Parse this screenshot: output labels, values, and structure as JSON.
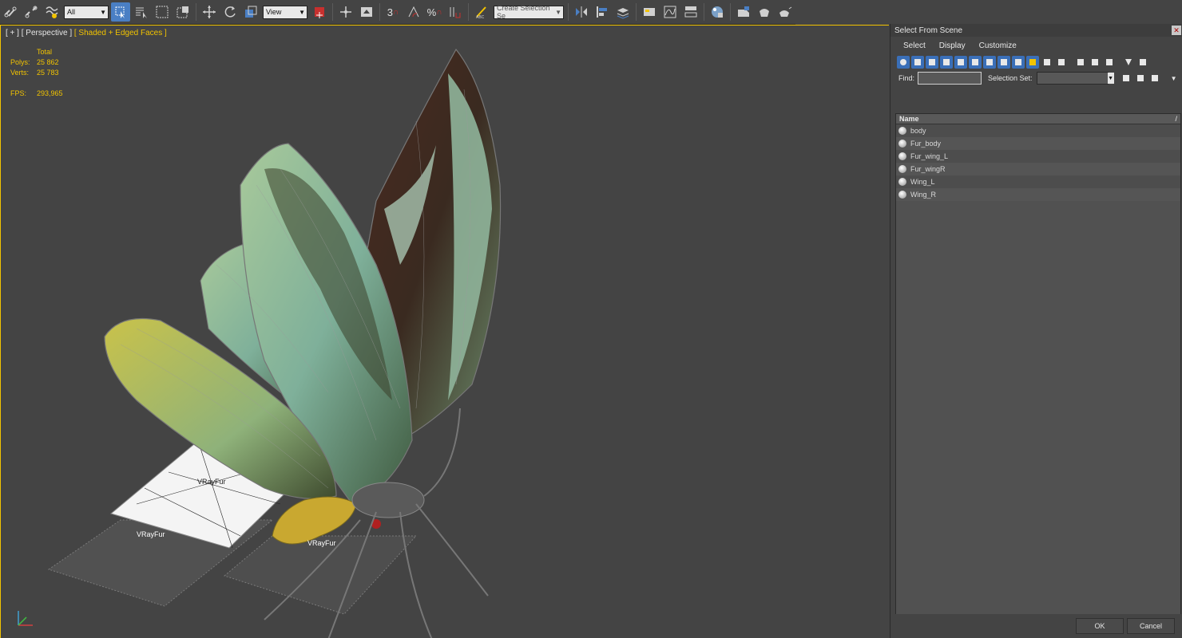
{
  "toolbar": {
    "selection_filter": "All",
    "reference_coord": "View",
    "named_selection_placeholder": "Create Selection Se",
    "snap_label": "3",
    "percent_snap_label": "%"
  },
  "viewport": {
    "label_plus": "[ + ]",
    "label_view": "[ Perspective ]",
    "label_shading": "[ Shaded + Edged Faces ]",
    "stats": {
      "total_header": "Total",
      "polys_label": "Polys:",
      "polys_value": "25 862",
      "verts_label": "Verts:",
      "verts_value": "25 783",
      "fps_label": "FPS:",
      "fps_value": "293,965"
    },
    "fur_labels": [
      "VRayFur",
      "VRayFur",
      "VRayFur"
    ],
    "axis_labels": {
      "x": "x",
      "y": "y",
      "z": "z"
    }
  },
  "panel": {
    "title": "Select From Scene",
    "menu": [
      "Select",
      "Display",
      "Customize"
    ],
    "find_label": "Find:",
    "find_value": "",
    "selection_set_label": "Selection Set:",
    "column_header": "Name",
    "items": [
      "body",
      "Fur_body",
      "Fur_wing_L",
      "Fur_wingR",
      "Wing_L",
      "Wing_R"
    ],
    "ok_label": "OK",
    "cancel_label": "Cancel"
  },
  "colors": {
    "viewport_border": "#f2c300",
    "accent_blue": "#3a6fb8",
    "background": "#444444"
  }
}
